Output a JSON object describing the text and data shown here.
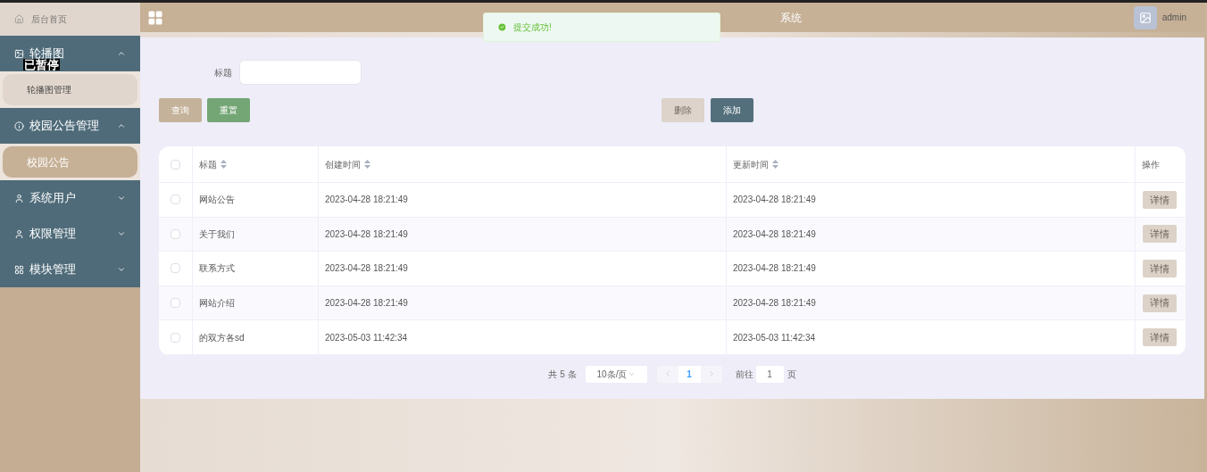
{
  "sidebar": {
    "home": {
      "label": "后台首页"
    },
    "groups": [
      {
        "label": "轮播图",
        "expanded": true,
        "children": [
          {
            "label": "轮播图管理",
            "selected": false
          }
        ]
      },
      {
        "label": "校园公告管理",
        "expanded": true,
        "children": [
          {
            "label": "校园公告",
            "selected": true
          }
        ]
      },
      {
        "label": "系统用户",
        "expanded": false
      },
      {
        "label": "权限管理",
        "expanded": false
      },
      {
        "label": "模块管理",
        "expanded": false
      }
    ]
  },
  "overlay": {
    "label": "已暂停"
  },
  "header": {
    "title": "系统",
    "user": "admin"
  },
  "toast": {
    "message": "提交成功!"
  },
  "search": {
    "label": "标题"
  },
  "buttons": [
    {
      "label": "查询",
      "kind": "query",
      "disabled": false
    },
    {
      "label": "重置",
      "kind": "reset",
      "disabled": false
    },
    {
      "label": "删除",
      "kind": "delete",
      "disabled": true
    },
    {
      "label": "添加",
      "kind": "add",
      "disabled": false
    }
  ],
  "table": {
    "all_checked": false,
    "columns": [
      {
        "label": "标题",
        "sortable": true
      },
      {
        "label": "创建时间",
        "sortable": true
      },
      {
        "label": "更新时间",
        "sortable": true
      },
      {
        "label": "操作",
        "sortable": false
      }
    ],
    "rows": [
      {
        "checked": false,
        "cells": [
          "网站公告",
          "2023-04-28 18:21:49",
          "2023-04-28 18:21:49"
        ],
        "action": "详情"
      },
      {
        "checked": false,
        "cells": [
          "关于我们",
          "2023-04-28 18:21:49",
          "2023-04-28 18:21:49"
        ],
        "action": "详情"
      },
      {
        "checked": false,
        "cells": [
          "联系方式",
          "2023-04-28 18:21:49",
          "2023-04-28 18:21:49"
        ],
        "action": "详情"
      },
      {
        "checked": false,
        "cells": [
          "网站介绍",
          "2023-04-28 18:21:49",
          "2023-04-28 18:21:49"
        ],
        "action": "详情"
      },
      {
        "checked": false,
        "cells": [
          "的双方各sd",
          "2023-05-03 11:42:34",
          "2023-05-03 11:42:34"
        ],
        "action": "详情"
      }
    ]
  },
  "pagination": {
    "total": "共 5 条",
    "page_size": "10条/页",
    "pages": [
      {
        "label": "1",
        "selected": true
      }
    ],
    "goto_label": "前往",
    "goto_value": "1",
    "goto_suffix": "页"
  }
}
